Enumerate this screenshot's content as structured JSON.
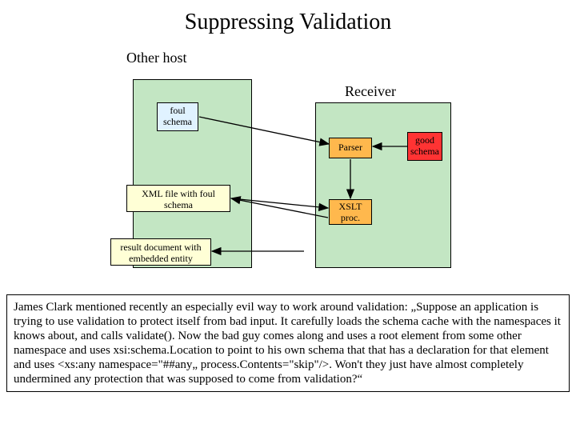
{
  "title": "Suppressing Validation",
  "subtitle": "Other host",
  "receiver_label": "Receiver",
  "boxes": {
    "foul_schema": "foul schema",
    "good_schema": "good schema",
    "parser": "Parser",
    "xslt": "XSLT proc.",
    "xml_file": "XML\nfile with foul schema",
    "result_doc": "result document with embedded entity"
  },
  "paragraph": "James Clark mentioned recently an especially evil way to work around validation: „Suppose an application is trying to use validation to protect itself from bad input. It carefully loads the schema cache with the namespaces it knows about, and calls validate().  Now the bad guy comes along and uses a root element from some other namespace and uses xsi:schema.Location to point to his own schema that that has a declaration for that element and uses <xs:any namespace=\"##any„ process.Contents=\"skip\"/>.  Won't they just have almost completely undermined any protection that was supposed to come from validation?“"
}
